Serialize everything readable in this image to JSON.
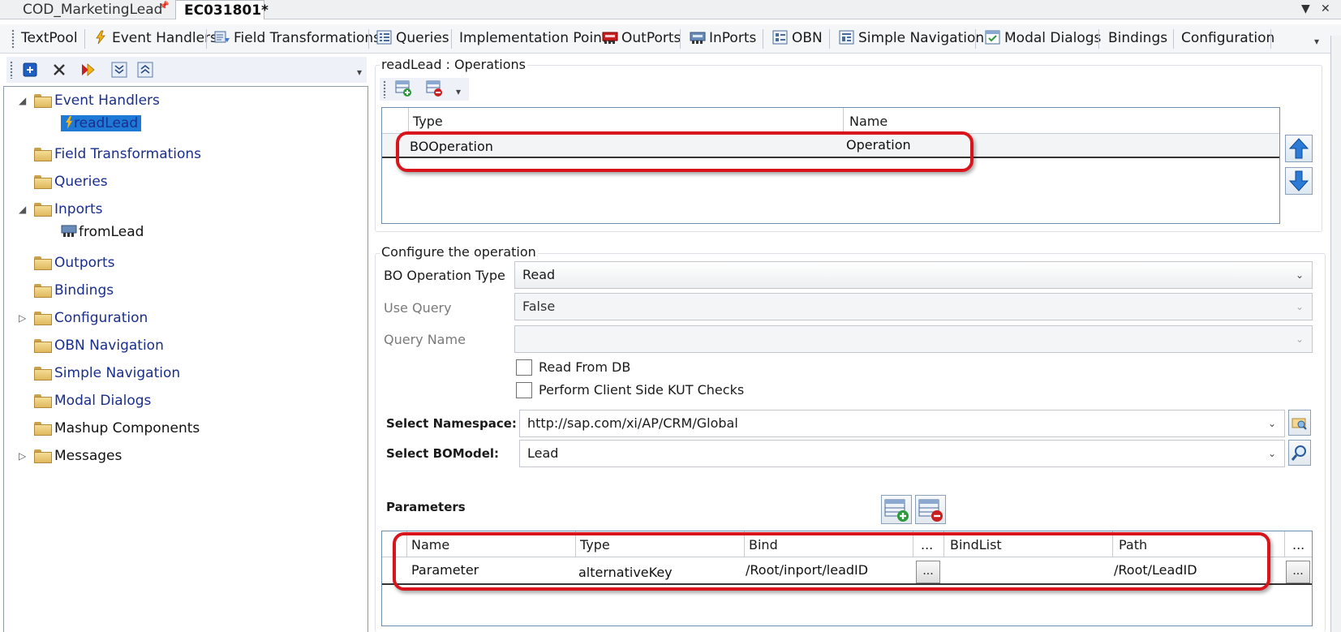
{
  "doc_tabs": [
    {
      "label": "COD_MarketingLead",
      "active": false
    },
    {
      "label": "EC031801*",
      "active": true
    }
  ],
  "window_controls": {
    "dropdown": "▼",
    "close": "✕"
  },
  "toolbar": {
    "items": [
      {
        "label": "TextPool",
        "icon": "none"
      },
      {
        "label": "Event Handlers",
        "icon": "lightning-icon"
      },
      {
        "label": "Field Transformations",
        "icon": "transform-icon"
      },
      {
        "label": "Queries",
        "icon": "query-icon"
      },
      {
        "label": "Implementation Points",
        "icon": "none"
      },
      {
        "label": "OutPorts",
        "icon": "outport-icon"
      },
      {
        "label": "InPorts",
        "icon": "inport-icon"
      },
      {
        "label": "OBN",
        "icon": "obn-icon"
      },
      {
        "label": "Simple Navigation",
        "icon": "navigation-icon"
      },
      {
        "label": "Modal Dialogs",
        "icon": "dialog-icon"
      },
      {
        "label": "Bindings",
        "icon": "none"
      },
      {
        "label": "Configuration",
        "icon": "none"
      }
    ]
  },
  "tree": {
    "nodes": [
      {
        "label": "Event Handlers",
        "expanded": true
      },
      {
        "label": "readLead",
        "selected": true
      },
      {
        "label": "Field Transformations"
      },
      {
        "label": "Queries"
      },
      {
        "label": "Inports",
        "expanded": true
      },
      {
        "label": "fromLead"
      },
      {
        "label": "Outports"
      },
      {
        "label": "Bindings"
      },
      {
        "label": "Configuration",
        "expandable": true
      },
      {
        "label": "OBN Navigation"
      },
      {
        "label": "Simple Navigation"
      },
      {
        "label": "Modal Dialogs"
      },
      {
        "label": "Mashup Components"
      },
      {
        "label": "Messages",
        "expandable": true
      }
    ]
  },
  "operations": {
    "group_label": "readLead : Operations",
    "columns": [
      "Type",
      "Name"
    ],
    "rows": [
      {
        "type": "BOOperation",
        "name": "Operation"
      }
    ]
  },
  "configure": {
    "group_label": "Configure the operation",
    "bo_operation_type": {
      "label": "BO Operation Type",
      "value": "Read"
    },
    "use_query": {
      "label": "Use Query",
      "value": "False"
    },
    "query_name": {
      "label": "Query Name",
      "value": ""
    },
    "read_from_db": {
      "label": "Read From DB",
      "checked": false
    },
    "client_kut": {
      "label": "Perform Client Side KUT Checks",
      "checked": false
    },
    "namespace": {
      "label": "Select Namespace:",
      "value": "http://sap.com/xi/AP/CRM/Global"
    },
    "bomodel": {
      "label": "Select BOModel:",
      "value": "Lead"
    }
  },
  "parameters": {
    "label": "Parameters",
    "columns": [
      "Name",
      "Type",
      "Bind",
      "...",
      "BindList",
      "Path",
      "..."
    ],
    "rows": [
      {
        "name": "Parameter",
        "type": "alternativeKey",
        "bind": "/Root/inport/leadID",
        "bind_btn": "...",
        "bindlist": "",
        "path": "/Root/LeadID",
        "path_btn": "..."
      }
    ]
  },
  "colors": {
    "highlight": "#d8141c",
    "tree_link": "#1a2e8c",
    "selection": "#1e7ad6",
    "grid_border": "#6f8fb0"
  }
}
